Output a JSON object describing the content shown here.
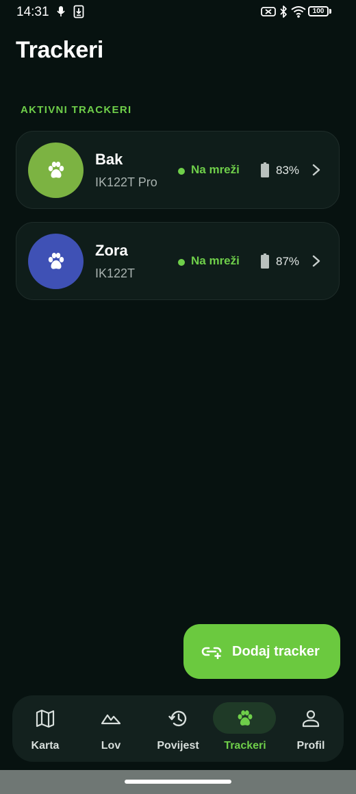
{
  "status_bar": {
    "time": "14:31",
    "battery": "100",
    "icons": [
      "mic-icon",
      "download-icon",
      "battery-saver-icon",
      "bluetooth-icon",
      "wifi-icon",
      "battery-icon"
    ]
  },
  "page": {
    "title": "Trackeri",
    "section_title": "AKTIVNI TRACKERI"
  },
  "trackers": [
    {
      "name": "Bak",
      "model": "IK122T Pro",
      "status": "Na mreži",
      "battery": "83%",
      "avatar_color": "#7cb342",
      "icon": "paw-icon"
    },
    {
      "name": "Zora",
      "model": "IK122T",
      "status": "Na mreži",
      "battery": "87%",
      "avatar_color": "#3f51b5",
      "icon": "paw-icon"
    }
  ],
  "fab": {
    "label": "Dodaj tracker",
    "icon": "add-link-icon"
  },
  "nav": {
    "items": [
      {
        "label": "Karta",
        "icon": "map-icon",
        "active": false
      },
      {
        "label": "Lov",
        "icon": "terrain-icon",
        "active": false
      },
      {
        "label": "Povijest",
        "icon": "history-icon",
        "active": false
      },
      {
        "label": "Trackeri",
        "icon": "paw-icon",
        "active": true
      },
      {
        "label": "Profil",
        "icon": "person-icon",
        "active": false
      }
    ]
  },
  "colors": {
    "background": "#071210",
    "accent": "#6fcf4a",
    "card": "#0f1d1a",
    "fab": "#6bc93f",
    "nav_bg": "#13211e",
    "nav_active_pill": "#1f3a27"
  }
}
